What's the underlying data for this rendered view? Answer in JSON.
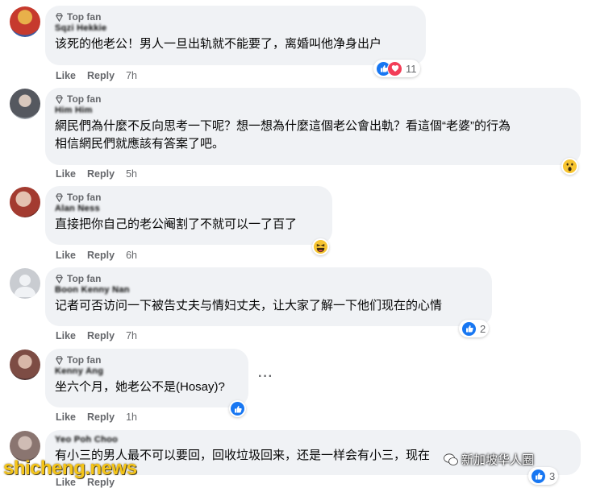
{
  "comments": [
    {
      "badge": "Top fan",
      "author": "Sqzi Hekkie",
      "text": "该死的他老公！男人一旦出轨就不能要了，离婚叫他净身出户",
      "like": "Like",
      "reply": "Reply",
      "time": "7h",
      "reaction_count": "11",
      "avatar_color": "#b8342c"
    },
    {
      "badge": "Top fan",
      "author": "Him Him",
      "text": "網民們為什麼不反向思考一下呢？想一想為什麼這個老公會出軌？看這個“老婆”的行為",
      "text2": "相信網民們就應該有答案了吧。",
      "like": "Like",
      "reply": "Reply",
      "time": "5h",
      "avatar_color": "#6d7077"
    },
    {
      "badge": "Top fan",
      "author": "Alan Ness",
      "text": "直接把你自己的老公阉割了不就可以一了百了",
      "like": "Like",
      "reply": "Reply",
      "time": "6h",
      "avatar_color": "#a8433a"
    },
    {
      "badge": "Top fan",
      "author": "Boon Kenny Nan",
      "text": "记者可否访问一下被告丈夫与情妇丈夫，让大家了解一下他们现在的心情",
      "like": "Like",
      "reply": "Reply",
      "time": "7h",
      "reaction_count": "2",
      "avatar_color": "#c9ccd1"
    },
    {
      "badge": "Top fan",
      "author": "Kenny Ang",
      "text": "坐六个月，她老公不是(Hosay)?",
      "like": "Like",
      "reply": "Reply",
      "time": "1h",
      "avatar_color": "#8a5a4f"
    },
    {
      "author": "Yeo Poh Choo",
      "text": "有小三的男人最不可以要回，回收垃圾回来，还是一样会有小三，现在",
      "like": "Like",
      "reply": "Reply",
      "reaction_count": "3",
      "avatar_color": "#9a8a86"
    }
  ],
  "icons": {
    "badge_icon": "diamond-icon",
    "more_icon": "more-dots-icon",
    "like_reaction": "thumbs-up-icon",
    "love_reaction": "heart-icon"
  },
  "more_dots": "···",
  "watermark": "shicheng.news",
  "wechat_watermark": "新加坡华人圈"
}
